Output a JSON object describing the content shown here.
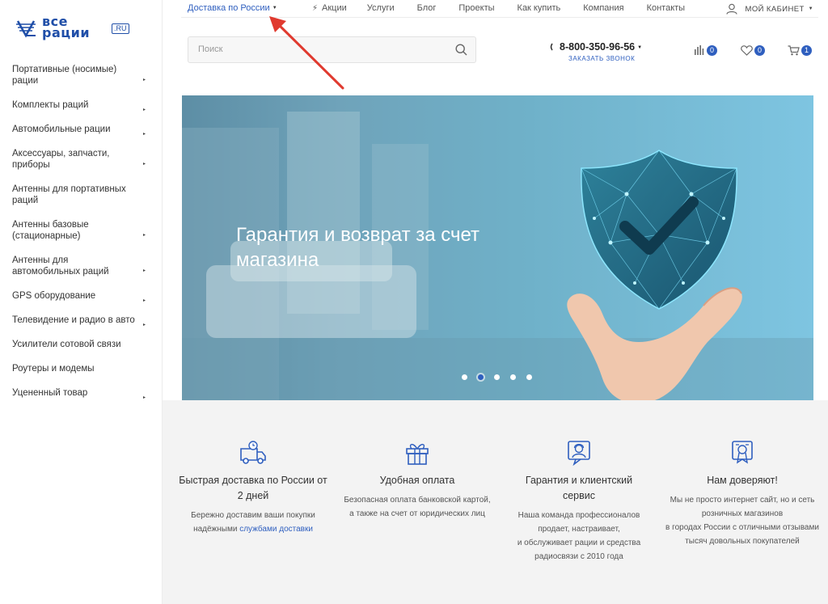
{
  "logo": {
    "text_line1": "все",
    "text_line2": "рации",
    "domain": ".RU"
  },
  "sidebar": {
    "items": [
      {
        "label": "Портативные (носимые) рации",
        "has_arrow": true
      },
      {
        "label": "Комплекты раций",
        "has_arrow": true
      },
      {
        "label": "Автомобильные рации",
        "has_arrow": true
      },
      {
        "label": "Аксессуары, запчасти, приборы",
        "has_arrow": true
      },
      {
        "label": "Антенны для портативных раций",
        "has_arrow": false
      },
      {
        "label": "Антенны базовые (стационарные)",
        "has_arrow": true
      },
      {
        "label": "Антенны для автомобильных раций",
        "has_arrow": true
      },
      {
        "label": "GPS оборудование",
        "has_arrow": true
      },
      {
        "label": "Телевидение и радио в авто",
        "has_arrow": true
      },
      {
        "label": "Усилители сотовой связи",
        "has_arrow": false
      },
      {
        "label": "Роутеры и модемы",
        "has_arrow": false
      },
      {
        "label": "Уцененный товар",
        "has_arrow": true
      }
    ]
  },
  "topbar": {
    "delivery": "Доставка по России",
    "nav": [
      "Акции",
      "Услуги",
      "Блог",
      "Проекты",
      "Как купить",
      "Компания",
      "Контакты"
    ],
    "account": "МОЙ КАБИНЕТ"
  },
  "search": {
    "placeholder": "Поиск"
  },
  "header": {
    "phone": "8-800-350-96-56",
    "callback": "ЗАКАЗАТЬ ЗВОНОК",
    "compare_count": "0",
    "favorites_count": "0",
    "cart_count": "1"
  },
  "banner": {
    "title": "Гарантия и возврат за счет магазина",
    "slides": 5,
    "active_slide": 2
  },
  "features": [
    {
      "title": "Быстрая доставка по России от 2 дней",
      "text": "Бережно доставим ваши покупки надёжными ",
      "link": "службами доставки",
      "icon": "delivery-truck-icon"
    },
    {
      "title": "Удобная оплата",
      "text": "Безопасная оплата банковской картой,\nа также на счет от юридических лиц",
      "icon": "gift-box-icon"
    },
    {
      "title": "Гарантия и клиентский сервис",
      "text": "Наша команда профессионалов продает, настраивает,\nи обслуживает рации и средства радиосвязи с 2010 года",
      "icon": "support-agent-icon"
    },
    {
      "title": "Нам доверяют!",
      "text": "Мы не просто интернет сайт, но и сеть розничных магазинов\nв городах России с отличными отзывами тысяч довольных покупателей",
      "icon": "certificate-icon"
    }
  ],
  "colors": {
    "accent": "#2f5fbf",
    "annotation_arrow": "#e03a2f",
    "features_bg": "#f3f3f3"
  }
}
